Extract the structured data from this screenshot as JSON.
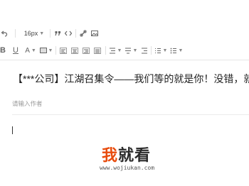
{
  "toolbar": {
    "font_size": "16px",
    "row1": [
      "undo-icon",
      "font-size-select",
      "quote-icon",
      "code-icon",
      "link-icon",
      "image-icon"
    ],
    "row2": [
      "bold-icon",
      "underline-icon",
      "font-color-icon",
      "highlight-icon",
      "align-left-icon",
      "align-center-icon",
      "align-right-icon",
      "align-justify-icon",
      "line-height-icon",
      "paragraph-spacing-icon",
      "ordered-list-icon",
      "unordered-list-icon"
    ]
  },
  "article": {
    "title": "【***公司】江湖召集令——我们等的就是你！没错，就是",
    "author_placeholder": "请输入作者"
  },
  "watermark": {
    "cn_part1": "我",
    "cn_part2": "就看",
    "url": "www.wojiukan.com",
    "accent_color": "#e84b0c"
  }
}
